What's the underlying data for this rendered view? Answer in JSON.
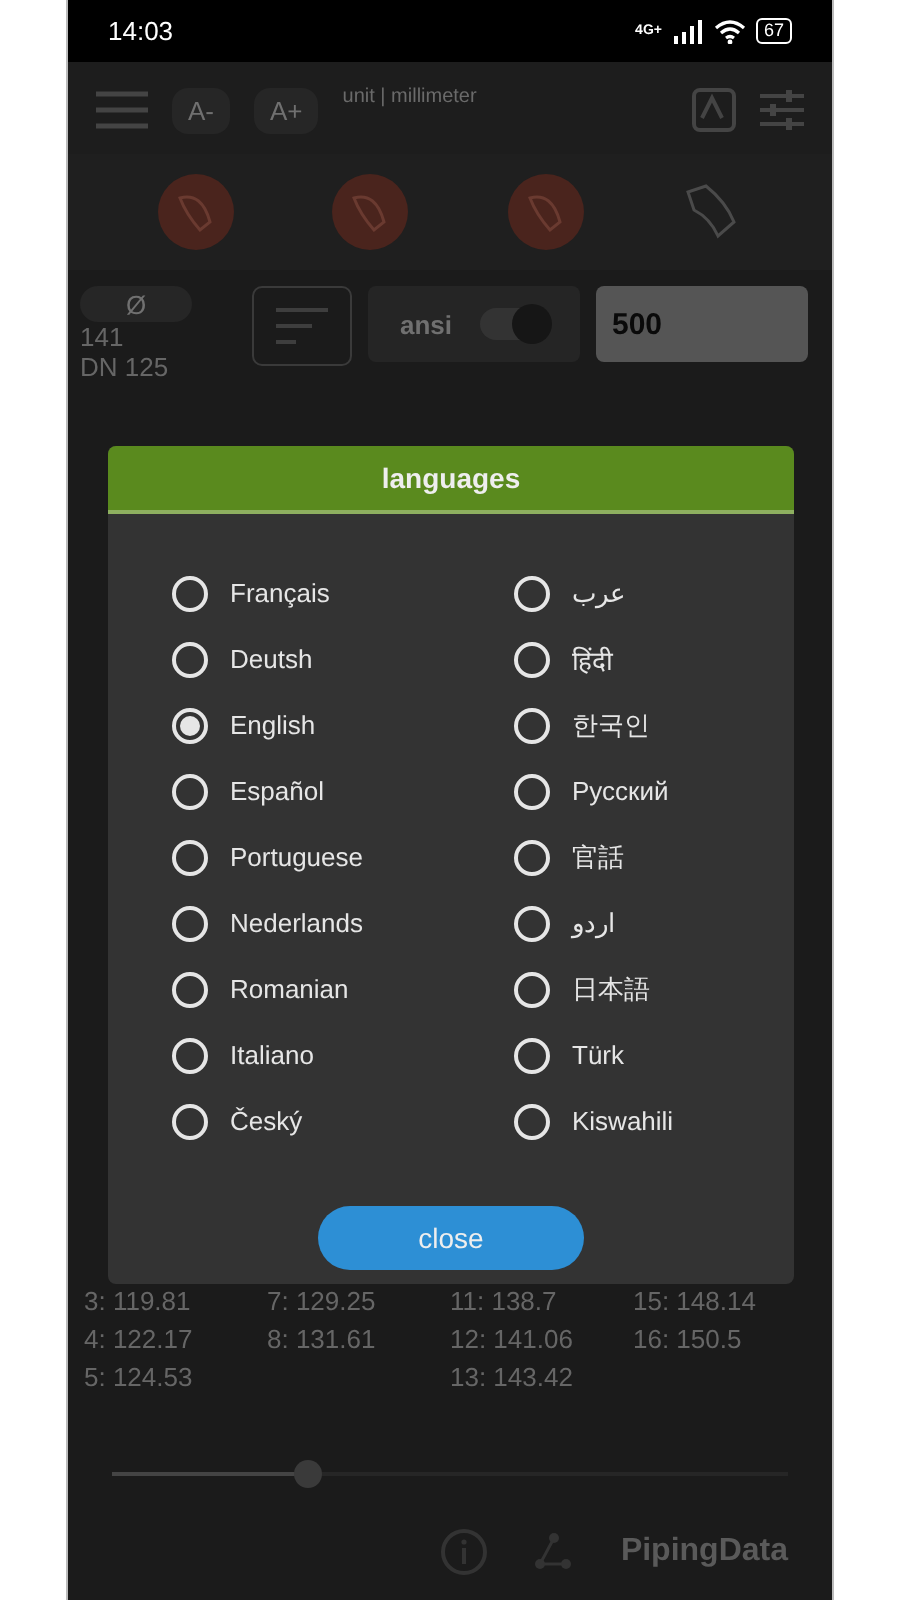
{
  "status_bar": {
    "time": "14:03",
    "network": "4G+",
    "battery": "67"
  },
  "toolbar": {
    "font_smaller": "A-",
    "font_larger": "A+",
    "unit": "unit | millimeter"
  },
  "controls": {
    "diameter_label": "Ø",
    "standard": {
      "label": "ansi",
      "on": true
    },
    "length": "500"
  },
  "size": {
    "outer": "141",
    "nominal": "DN 125"
  },
  "values": [
    [
      "3: 119.81",
      "4: 122.17",
      "5: 124.53"
    ],
    [
      "7: 129.25",
      "8: 131.61"
    ],
    [
      "11: 138.7",
      "12: 141.06",
      "13: 143.42"
    ],
    [
      "15: 148.14",
      "16: 150.5"
    ]
  ],
  "slider": {
    "level": 0.29
  },
  "footer": {
    "brand": "PipingData"
  },
  "dialog": {
    "title": "languages",
    "close": "close",
    "languages": [
      {
        "label": "Français",
        "selected": false
      },
      {
        "label": "Deutsh",
        "selected": false
      },
      {
        "label": "English",
        "selected": true
      },
      {
        "label": "Español",
        "selected": false
      },
      {
        "label": "Portuguese",
        "selected": false
      },
      {
        "label": "Nederlands",
        "selected": false
      },
      {
        "label": "Romanian",
        "selected": false
      },
      {
        "label": "Italiano",
        "selected": false
      },
      {
        "label": "Český",
        "selected": false
      },
      {
        "label": "عرب",
        "selected": false
      },
      {
        "label": "हिंदी",
        "selected": false
      },
      {
        "label": "한국인",
        "selected": false
      },
      {
        "label": "Русский",
        "selected": false
      },
      {
        "label": "官話",
        "selected": false
      },
      {
        "label": "اردو",
        "selected": false
      },
      {
        "label": "日本語",
        "selected": false
      },
      {
        "label": "Türk",
        "selected": false
      },
      {
        "label": "Kiswahili",
        "selected": false
      }
    ]
  }
}
